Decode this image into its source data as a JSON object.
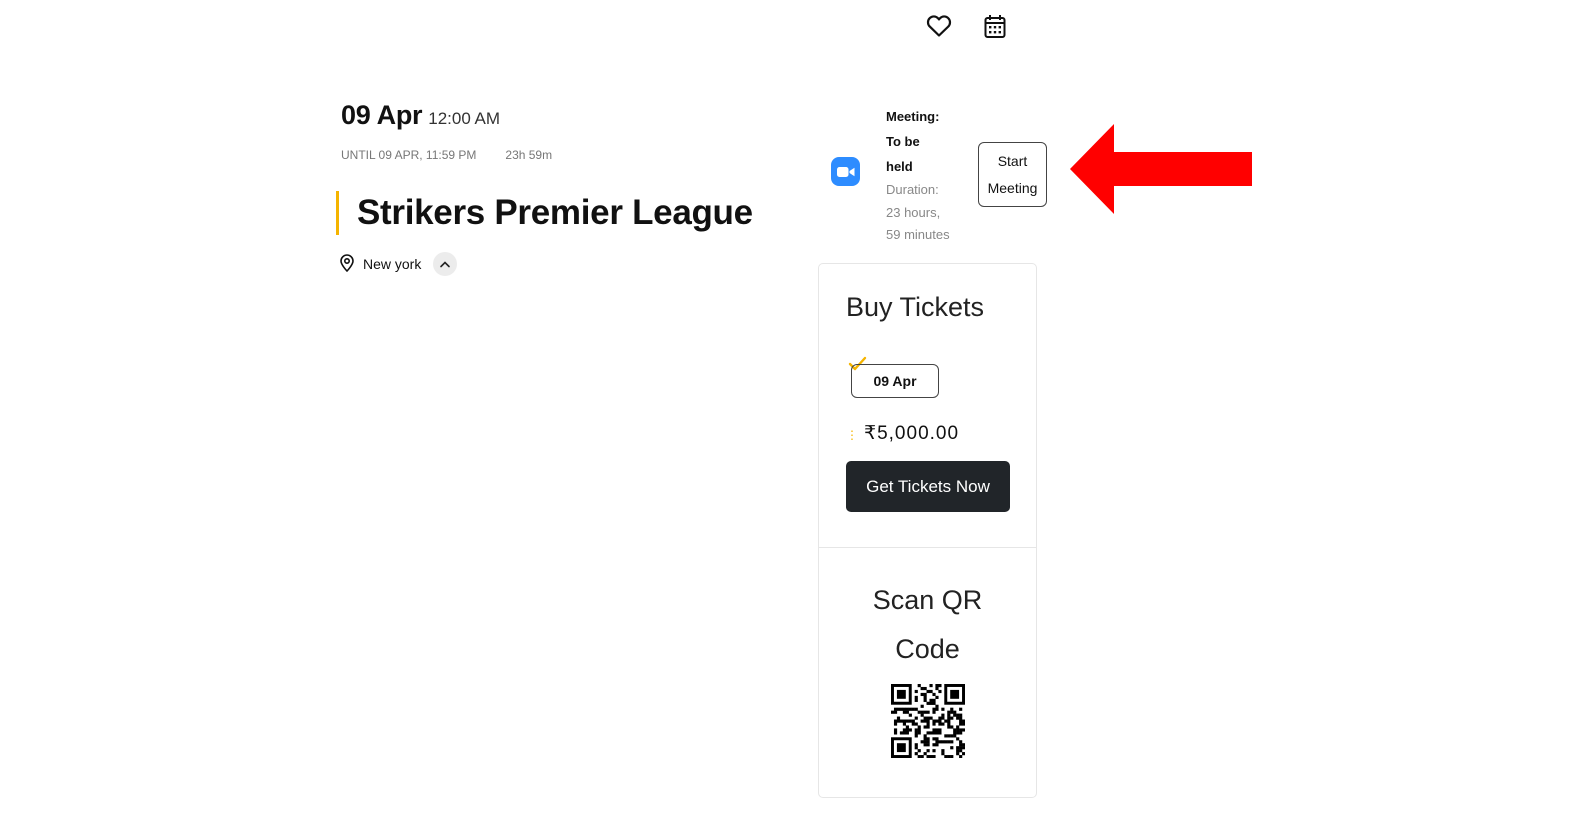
{
  "header": {
    "icons": [
      "heart-icon",
      "calendar-icon"
    ]
  },
  "event": {
    "day": "09 Apr",
    "time": "12:00 AM",
    "until": "UNTIL 09 APR, 11:59 PM",
    "duration_short": "23h 59m",
    "title": "Strikers Premier League",
    "location": "New york"
  },
  "meeting": {
    "label_line1": "Meeting:",
    "label_line2": "To be",
    "label_line3": "held",
    "duration_label": "Duration:",
    "duration_line1": "23 hours,",
    "duration_line2": "59 minutes",
    "start_line1": "Start",
    "start_line2": "Meeting"
  },
  "tickets": {
    "title": "Buy Tickets",
    "date_chip": "09 Apr",
    "price": "₹5,000.00",
    "cta": "Get Tickets Now"
  },
  "qr": {
    "title_line1": "Scan QR",
    "title_line2": "Code"
  },
  "colors": {
    "accent": "#f5b400",
    "zoom_blue": "#2d8cff",
    "button_dark": "#212529",
    "annotation_arrow": "#ff0000"
  }
}
